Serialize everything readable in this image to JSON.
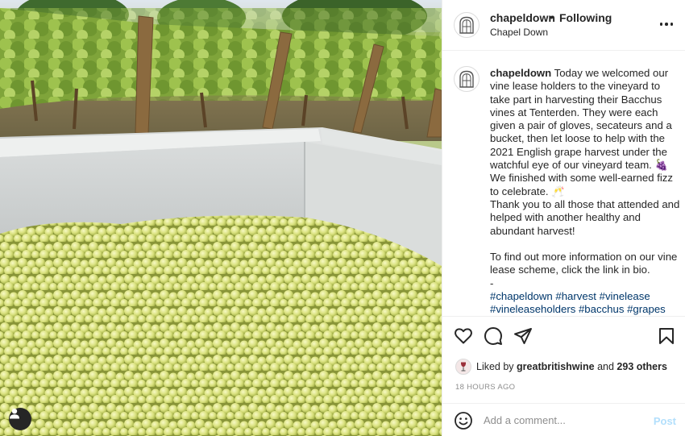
{
  "post": {
    "username": "chapeldown",
    "separator": "•",
    "follow_status": "Following",
    "location": "Chapel Down",
    "caption_text": " Today we welcomed our vine lease holders to the vineyard to take part in harvesting their Bacchus vines at Tenterden. They were each given a pair of gloves, secateurs and a bucket, then let loose to help with the 2021 English grape harvest under the watchful eye of our vineyard team. 🍇 We finished with some well-earned fizz to celebrate. 🥂\nThank you to all those that attended and helped with another healthy and abundant harvest!\n\nTo find out more information on our vine lease scheme, click the link in bio.\n-\n",
    "hashtags": "#chapeldown #harvest #vinelease #vineleaseholders #bacchus #grapes #vineyard #tenterden #winery #wine",
    "likes": {
      "prefix": "Liked by ",
      "liker": "greatbritishwine",
      "middle": " and ",
      "count": "293 others"
    },
    "timestamp": "18 HOURS AGO"
  },
  "comment": {
    "placeholder": "Add a comment...",
    "post_label": "Post"
  },
  "icons": {
    "avatar": "chapel-window-logo",
    "tag": "user-tag-icon",
    "like": "heart-icon",
    "comment": "comment-bubble-icon",
    "share": "paper-plane-icon",
    "save": "bookmark-icon",
    "emoji": "smiley-icon",
    "more": "ellipsis-icon"
  },
  "colors": {
    "text": "#262626",
    "secondary": "#8e8e8e",
    "link": "#00376b",
    "post_disabled": "#b2dffc",
    "divider": "#efefef"
  }
}
